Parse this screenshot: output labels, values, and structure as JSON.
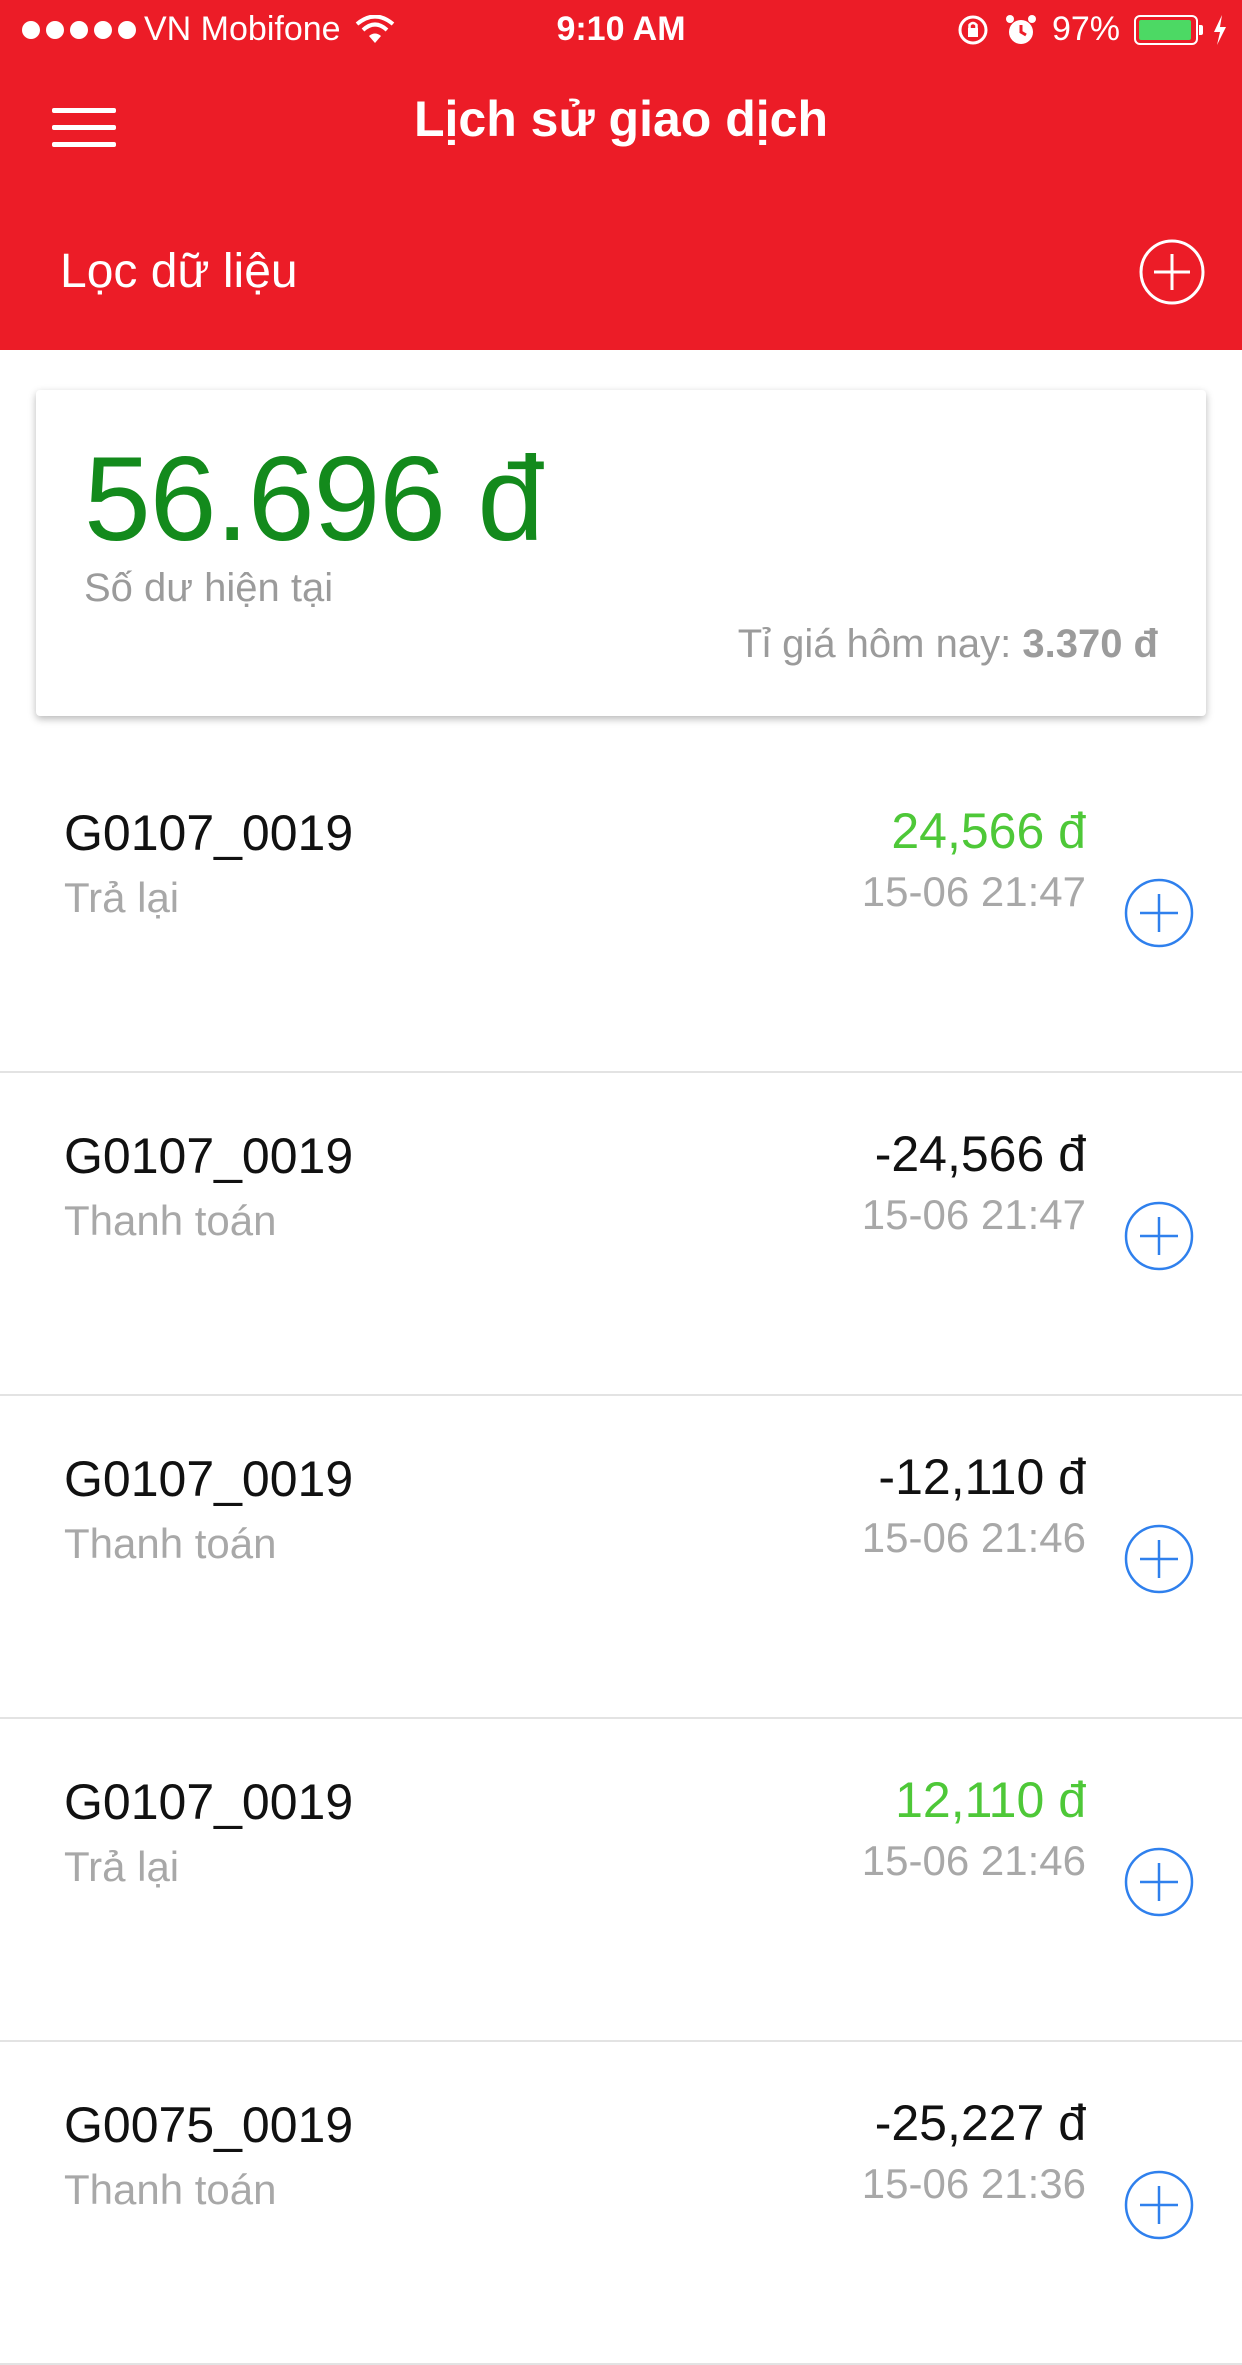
{
  "status_bar": {
    "carrier": "VN Mobifone",
    "time": "9:10 AM",
    "battery": "97%",
    "battery_level": 0.97,
    "icons": [
      "signal-dots-icon",
      "wifi-icon",
      "rotation-lock-icon",
      "alarm-icon",
      "battery-icon",
      "charging-icon"
    ]
  },
  "header": {
    "title": "Lịch sử giao dịch",
    "menu_icon": "hamburger-menu-icon",
    "filter_label": "Lọc dữ liệu",
    "filter_add_icon": "plus-circle-icon"
  },
  "balance": {
    "amount": "56.696 đ",
    "label": "Số dư hiện tại",
    "rate_label": "Tỉ giá hôm nay:",
    "rate_value": "3.370 đ"
  },
  "colors": {
    "brand_red": "#ec1c27",
    "balance_green": "#138a1c",
    "positive_green": "#4ec838",
    "icon_blue": "#2f80ed"
  },
  "transactions": [
    {
      "code": "G0107_0019",
      "type": "Trả lại",
      "amount": "24,566 đ",
      "positive": true,
      "time": "15-06 21:47"
    },
    {
      "code": "G0107_0019",
      "type": "Thanh toán",
      "amount": "-24,566 đ",
      "positive": false,
      "time": "15-06 21:47"
    },
    {
      "code": "G0107_0019",
      "type": "Thanh toán",
      "amount": "-12,110 đ",
      "positive": false,
      "time": "15-06 21:46"
    },
    {
      "code": "G0107_0019",
      "type": "Trả lại",
      "amount": "12,110 đ",
      "positive": true,
      "time": "15-06 21:46"
    },
    {
      "code": "G0075_0019",
      "type": "Thanh toán",
      "amount": "-25,227 đ",
      "positive": false,
      "time": "15-06 21:36"
    }
  ]
}
